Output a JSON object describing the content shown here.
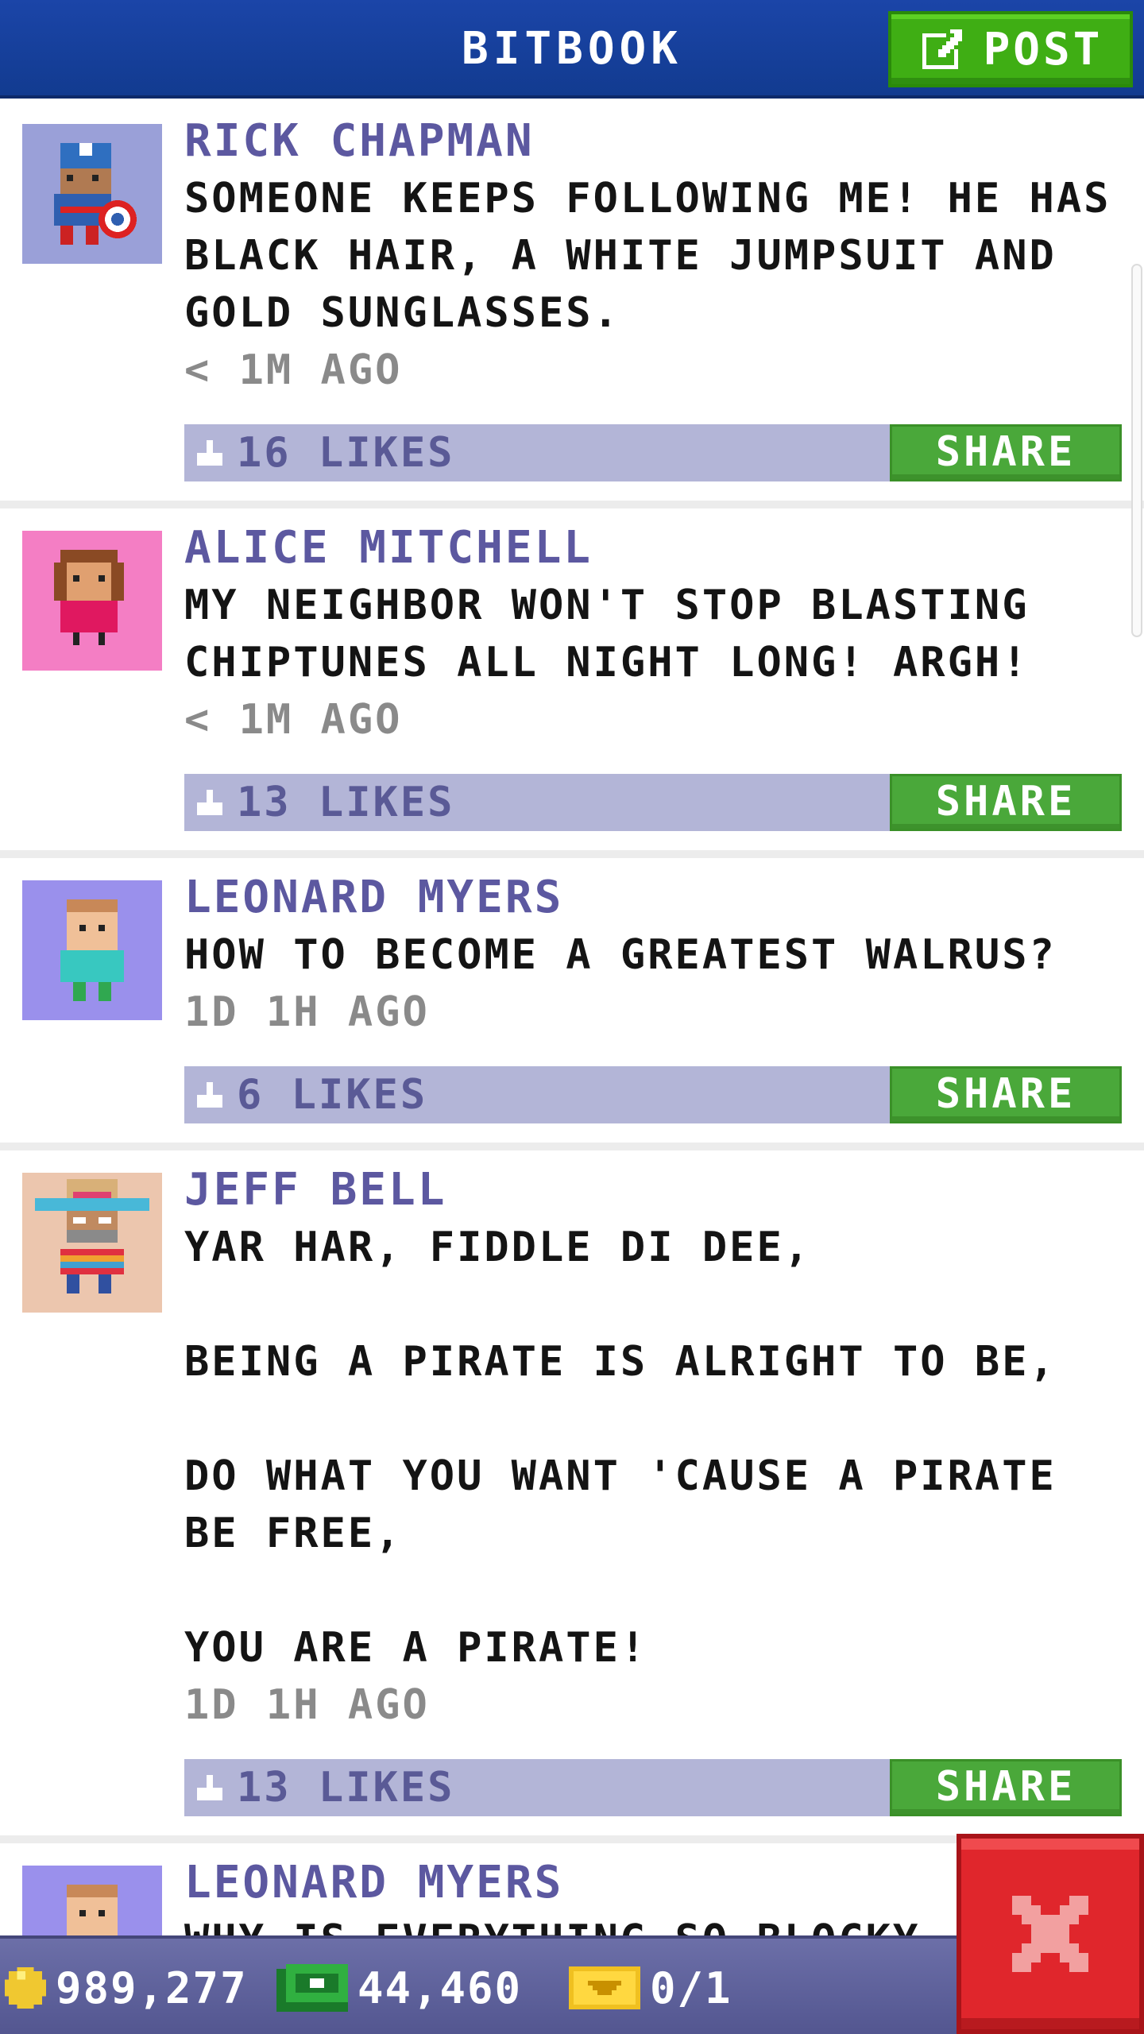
{
  "header": {
    "title": "BITBOOK",
    "post_label": "POST"
  },
  "posts": [
    {
      "author": "RICK CHAPMAN",
      "message": "SOMEONE KEEPS FOLLOWING ME! HE HAS BLACK HAIR, A WHITE JUMPSUIT AND GOLD SUNGLASSES.",
      "time": "< 1M AGO",
      "likes": "16 LIKES",
      "share_label": "SHARE",
      "avatar_bg": "#9aa0d8",
      "avatar_icon": "captain-avatar-icon"
    },
    {
      "author": "ALICE MITCHELL",
      "message": "MY NEIGHBOR WON'T STOP BLASTING CHIPTUNES ALL NIGHT LONG! ARGH!",
      "time": "< 1M AGO",
      "likes": "13 LIKES",
      "share_label": "SHARE",
      "avatar_bg": "#f47ec4",
      "avatar_icon": "girl-avatar-icon"
    },
    {
      "author": "LEONARD MYERS",
      "message": "HOW TO BECOME A GREATEST WALRUS?",
      "time": "1D 1H AGO",
      "likes": "6 LIKES",
      "share_label": "SHARE",
      "avatar_bg": "#9a90ec",
      "avatar_icon": "boy-avatar-icon"
    },
    {
      "author": "JEFF BELL",
      "message": "YAR HAR, FIDDLE DI DEE,\n\nBEING A PIRATE IS ALRIGHT TO BE,\n\nDO WHAT YOU WANT 'CAUSE A PIRATE BE FREE,\n\nYOU ARE A PIRATE!",
      "time": "1D 1H AGO",
      "likes": "13 LIKES",
      "share_label": "SHARE",
      "avatar_bg": "#ecc6ae",
      "avatar_icon": "sombrero-avatar-icon"
    },
    {
      "author": "LEONARD MYERS",
      "message": "WHY IS EVERYTHING SO BLOCKY",
      "avatar_bg": "#9a90ec",
      "avatar_icon": "boy-avatar-icon"
    }
  ],
  "bottom_bar": {
    "coins": "989,277",
    "cash": "44,460",
    "tickets": "0/1",
    "coin_icon": "coin-icon",
    "cash_icon": "cash-icon",
    "ticket_icon": "ticket-icon"
  },
  "colors": {
    "header_bg": "#1b45a8",
    "post_button": "#3fae14",
    "author": "#5c58a0",
    "like_bar": "#b3b5d7",
    "share_button": "#4aa83a",
    "close_button": "#e0262c",
    "bottom_bar": "#6c6fa8"
  }
}
